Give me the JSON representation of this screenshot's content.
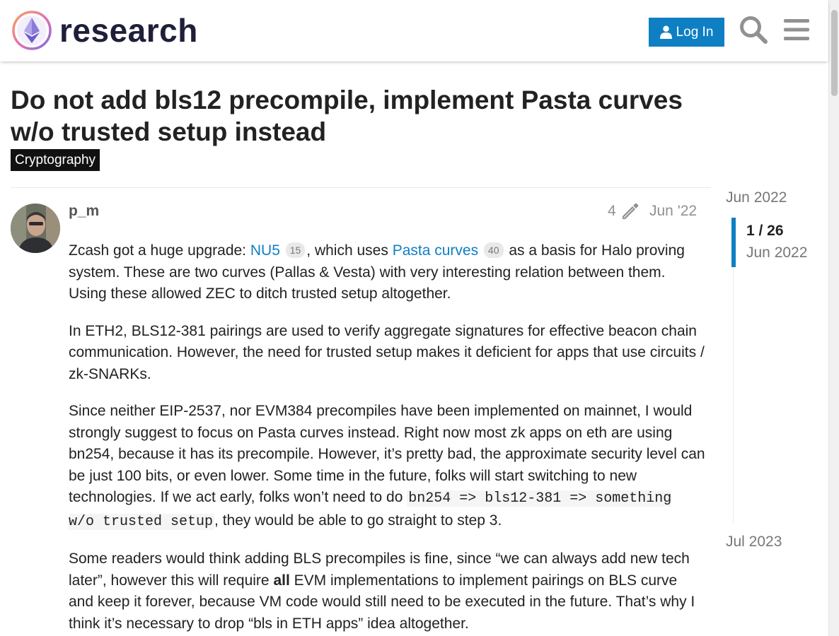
{
  "header": {
    "site_name": "research",
    "login_label": "Log In"
  },
  "topic": {
    "title": "Do not add bls12 precompile, implement Pasta curves w/o trusted setup instead",
    "category": "Cryptography",
    "category_color": "#111111"
  },
  "post": {
    "username": "p_m",
    "edit_count": "4",
    "date": "Jun '22",
    "p1": {
      "before": "Zcash got a huge upgrade: ",
      "link1": "NU5",
      "badge1": "15",
      "middle": ", which uses ",
      "link2": "Pasta curves",
      "badge2": "40",
      "after": " as a basis for Halo proving system. These are two curves (Pallas & Vesta) with very interesting relation between them. Using these allowed ZEC to ditch trusted setup altogether."
    },
    "p2": "In ETH2, BLS12-381 pairings are used to verify aggregate signatures for effective beacon chain communication. However, the need for trusted setup makes it deficient for apps that use circuits / zk-SNARKs.",
    "p3": {
      "before": "Since neither EIP-2537, nor EVM384 precompiles have been implemented on mainnet, I would strongly suggest to focus on Pasta curves instead. Right now most zk apps on eth are using bn254, because it has its precompile. However, it’s pretty bad, the approximate security level can be just 100 bits, or even lower. Some time in the future, folks will start switching to new technologies. If we act early, folks won’t need to do ",
      "code": "bn254 => bls12-381 => something w/o trusted setup",
      "after": ", they would be able to go straight to step 3."
    },
    "p4": {
      "before": "Some readers would think adding BLS precompiles is fine, since “we can always add new tech later”, however this will require ",
      "bold": "all",
      "after": " EVM implementations to implement pairings on BLS curve and keep it forever, because VM code would still need to be executed in the future. That’s why I think it’s necessary to drop “bls in ETH apps” idea altogether."
    }
  },
  "timeline": {
    "start_date": "Jun 2022",
    "position": "1 / 26",
    "position_date": "Jun 2022",
    "end_date": "Jul 2023"
  },
  "colors": {
    "accent": "#0f7fc4",
    "muted": "#919191"
  }
}
